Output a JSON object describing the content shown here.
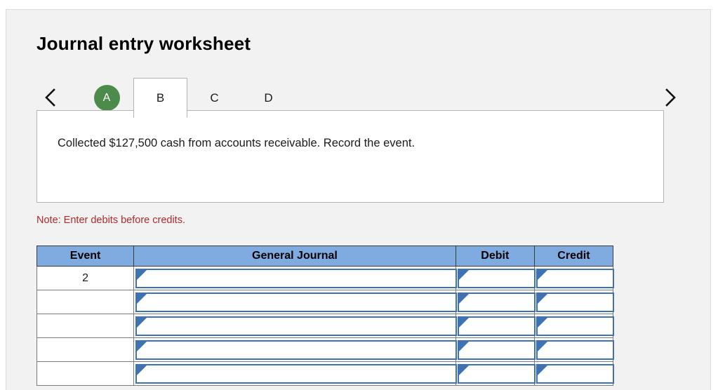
{
  "header": {
    "title": "Journal entry worksheet"
  },
  "nav": {
    "prev_icon": "chevron-left-icon",
    "next_icon": "chevron-right-icon"
  },
  "tabs": [
    {
      "label": "A",
      "state": "completed"
    },
    {
      "label": "B",
      "state": "active"
    },
    {
      "label": "C",
      "state": "inactive"
    },
    {
      "label": "D",
      "state": "inactive"
    }
  ],
  "prompt": {
    "text": "Collected $127,500 cash from accounts receivable. Record the event."
  },
  "note": {
    "text": "Note: Enter debits before credits."
  },
  "table": {
    "headers": [
      "Event",
      "General Journal",
      "Debit",
      "Credit"
    ],
    "rows": [
      {
        "event": "2",
        "journal": "",
        "debit": "",
        "credit": ""
      },
      {
        "event": "",
        "journal": "",
        "debit": "",
        "credit": ""
      },
      {
        "event": "",
        "journal": "",
        "debit": "",
        "credit": ""
      },
      {
        "event": "",
        "journal": "",
        "debit": "",
        "credit": ""
      },
      {
        "event": "",
        "journal": "",
        "debit": "",
        "credit": ""
      }
    ]
  },
  "colors": {
    "header_blue": "#7fabe0",
    "input_border_blue": "#3f72b0",
    "completed_tab_green": "#4c8b4a",
    "note_red": "#b02a2a",
    "panel_background": "#f2f2f2"
  }
}
